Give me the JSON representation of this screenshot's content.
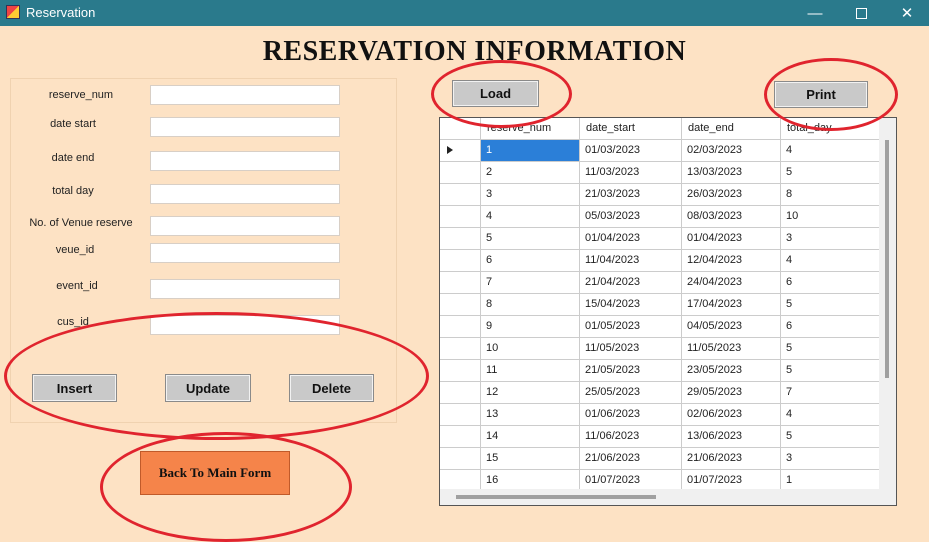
{
  "window": {
    "title": "Reservation",
    "min_glyph": "—",
    "close_glyph": "✕"
  },
  "heading": "RESERVATION INFORMATION",
  "form": {
    "fields": [
      {
        "label": "reserve_num",
        "value": ""
      },
      {
        "label": "date start",
        "value": ""
      },
      {
        "label": "date end",
        "value": ""
      },
      {
        "label": "total day",
        "value": ""
      },
      {
        "label": "No. of Venue reserve",
        "value": ""
      },
      {
        "label": "veue_id",
        "value": ""
      },
      {
        "label": "event_id",
        "value": ""
      },
      {
        "label": "cus_id",
        "value": ""
      }
    ],
    "buttons": {
      "insert": "Insert",
      "update": "Update",
      "delete": "Delete"
    },
    "back_button": "Back To Main Form"
  },
  "toolbar": {
    "load": "Load",
    "print": "Print"
  },
  "table": {
    "columns": [
      "reserve_num",
      "date_start",
      "date_end",
      "total_day"
    ],
    "rows": [
      [
        "1",
        "01/03/2023",
        "02/03/2023",
        "4"
      ],
      [
        "2",
        "11/03/2023",
        "13/03/2023",
        "5"
      ],
      [
        "3",
        "21/03/2023",
        "26/03/2023",
        "8"
      ],
      [
        "4",
        "05/03/2023",
        "08/03/2023",
        "10"
      ],
      [
        "5",
        "01/04/2023",
        "01/04/2023",
        "3"
      ],
      [
        "6",
        "11/04/2023",
        "12/04/2023",
        "4"
      ],
      [
        "7",
        "21/04/2023",
        "24/04/2023",
        "6"
      ],
      [
        "8",
        "15/04/2023",
        "17/04/2023",
        "5"
      ],
      [
        "9",
        "01/05/2023",
        "04/05/2023",
        "6"
      ],
      [
        "10",
        "11/05/2023",
        "11/05/2023",
        "5"
      ],
      [
        "11",
        "21/05/2023",
        "23/05/2023",
        "5"
      ],
      [
        "12",
        "25/05/2023",
        "29/05/2023",
        "7"
      ],
      [
        "13",
        "01/06/2023",
        "02/06/2023",
        "4"
      ],
      [
        "14",
        "11/06/2023",
        "13/06/2023",
        "5"
      ],
      [
        "15",
        "21/06/2023",
        "21/06/2023",
        "3"
      ],
      [
        "16",
        "01/07/2023",
        "01/07/2023",
        "1"
      ]
    ]
  },
  "colors": {
    "background": "#fde2c4",
    "titlebar": "#2a7a8c",
    "back_button": "#f5844a",
    "selection": "#2b7fd8",
    "annotation": "#e0242e"
  }
}
